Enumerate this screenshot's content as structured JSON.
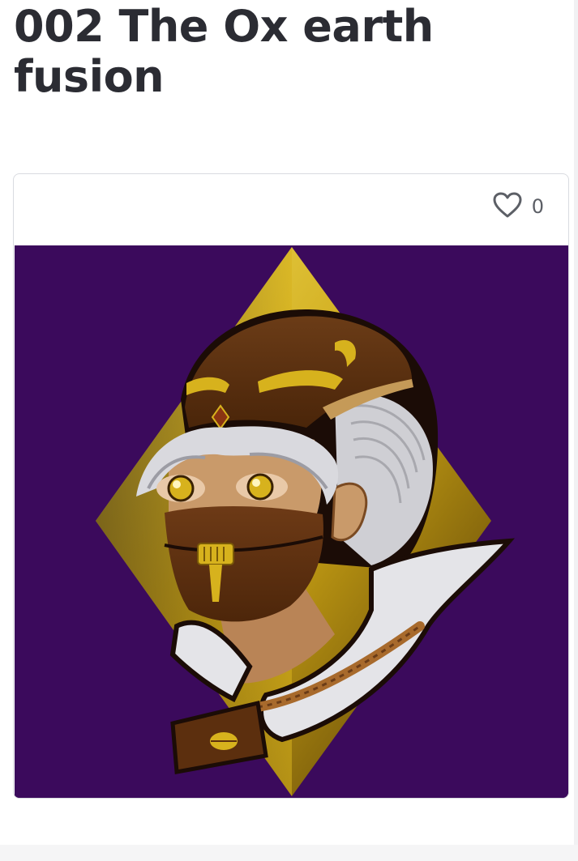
{
  "page": {
    "title": "002 The Ox earth fusion"
  },
  "card": {
    "like_icon": "heart-outline-icon",
    "like_count": "0",
    "artwork": {
      "subject": "Illustrated portrait of a masked, white-haired warrior with a golden ox-horned helmet in front of a gold diamond",
      "background_color": "#3b0a5c",
      "accent_color": "#d7b21d"
    }
  }
}
